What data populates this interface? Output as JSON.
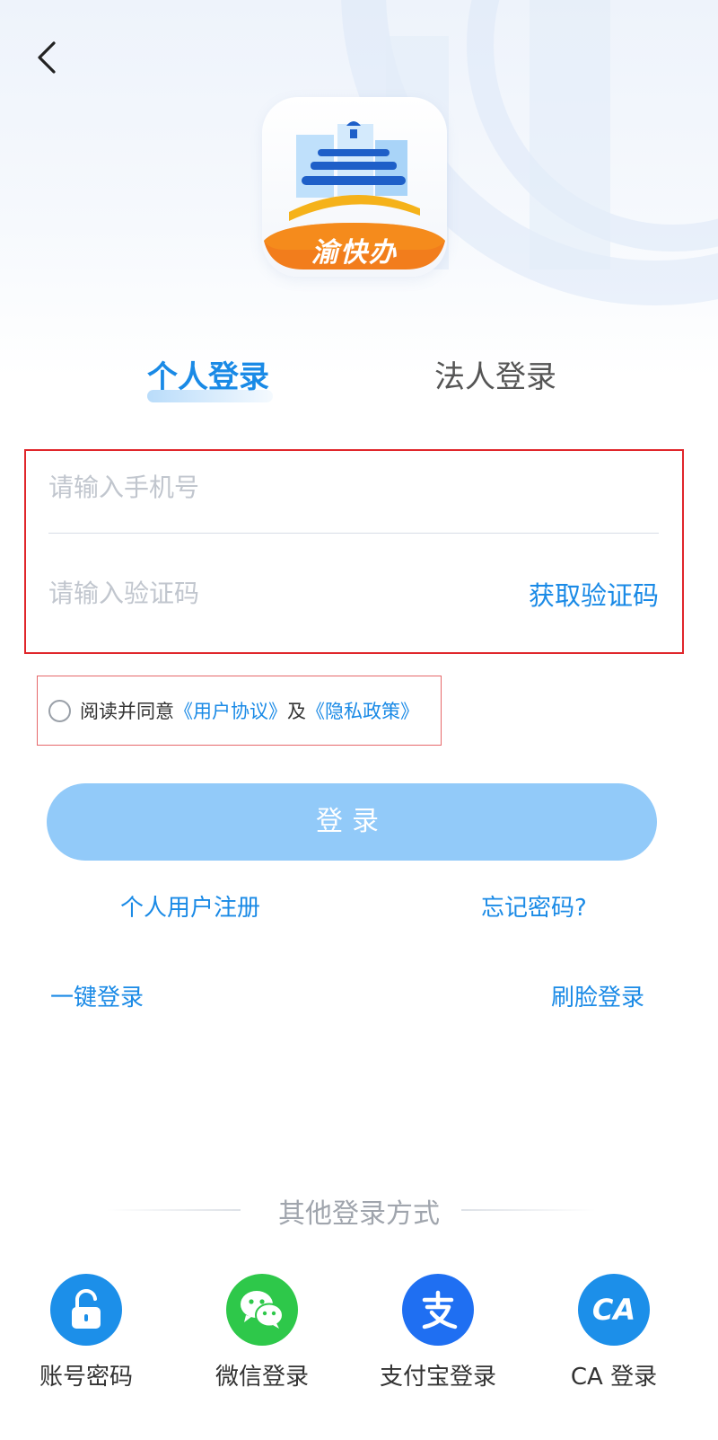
{
  "logo": {
    "text": "渝快办"
  },
  "tabs": [
    {
      "label": "个人登录",
      "active": true
    },
    {
      "label": "法人登录",
      "active": false
    }
  ],
  "form": {
    "phone_placeholder": "请输入手机号",
    "code_placeholder": "请输入验证码",
    "get_code_label": "获取验证码"
  },
  "agreement": {
    "prefix": "阅读并同意",
    "user_agreement": "《用户协议》",
    "and": "及",
    "privacy_policy": "《隐私政策》"
  },
  "login_button": "登录",
  "links": {
    "register": "个人用户注册",
    "forgot": "忘记密码?",
    "one_key": "一键登录",
    "face": "刷脸登录"
  },
  "other_login": {
    "title": "其他登录方式",
    "methods": [
      {
        "label": "账号密码",
        "icon": "unlock-icon",
        "color": "#1c8fe9"
      },
      {
        "label": "微信登录",
        "icon": "wechat-icon",
        "color": "#2ec84a"
      },
      {
        "label": "支付宝登录",
        "icon": "alipay-icon",
        "color": "#1f6ff2"
      },
      {
        "label": "CA 登录",
        "icon_text": "CA",
        "icon": "ca-icon",
        "color": "#1c8fe9"
      }
    ]
  },
  "colors": {
    "accent": "#1a8ae6",
    "button": "#92caf9",
    "highlight_border": "#e0262b"
  }
}
